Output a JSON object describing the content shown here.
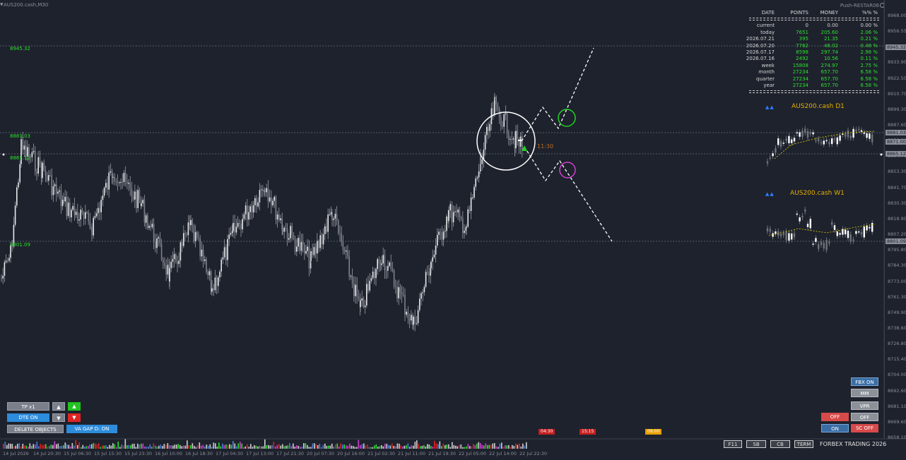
{
  "window": {
    "title": "AUS200.cash,M30",
    "right_label": "Push-RESTAR06"
  },
  "price_axis": {
    "ticks": [
      "8968.00",
      "8956.55",
      "8945.32",
      "8933.90",
      "8922.50",
      "8910.70",
      "8899.30",
      "8887.60",
      "8876.20",
      "8864.70",
      "8853.30",
      "8841.70",
      "8830.30",
      "8818.90",
      "8807.20",
      "8795.80",
      "8784.30",
      "8773.00",
      "8761.30",
      "8749.90",
      "8738.60",
      "8726.80",
      "8715.40",
      "8704.00",
      "8692.60",
      "8681.10",
      "8669.60",
      "8658.10"
    ],
    "boxed": [
      "8945.32",
      "8881.03",
      "8871.00",
      "8865.12",
      "8801.09"
    ]
  },
  "levels": [
    {
      "label": "8945.32"
    },
    {
      "label": "8881.03"
    },
    {
      "label": "8865.12"
    },
    {
      "label": "8801.09"
    }
  ],
  "time_axis": {
    "ticks": [
      "14 Jul 2026",
      "14 Jul 20:30",
      "15 Jul 06:30",
      "15 Jul 15:30",
      "15 Jul 23:30",
      "16 Jul 10:00",
      "16 Jul 18:30",
      "17 Jul 04:30",
      "17 Jul 13:00",
      "17 Jul 21:30",
      "20 Jul 07:30",
      "20 Jul 16:00",
      "21 Jul 02:30",
      "21 Jul 11:00",
      "21 Jul 19:30",
      "22 Jul 05:00",
      "22 Jul 14:00",
      "22 Jul 22:30"
    ]
  },
  "countdown": "11:30",
  "stats": {
    "headers": {
      "date": "DATE",
      "points": "POINTS",
      "money": "MONEY",
      "pct": "%% %"
    },
    "rows": [
      {
        "date": "current",
        "points": "0",
        "money": "0.00",
        "pct": "0.00 %",
        "positive": false
      },
      {
        "date": "today",
        "points": "7651",
        "money": "205.60",
        "pct": "2.06 %",
        "positive": true
      },
      {
        "date": "2026.07.21",
        "points": "395",
        "money": "21.35",
        "pct": "0.21 %",
        "positive": true
      },
      {
        "date": "2026.07.20",
        "points": "7762",
        "money": "48.02",
        "pct": "0.48 %",
        "positive": true
      },
      {
        "date": "2026.07.17",
        "points": "8598",
        "money": "297.74",
        "pct": "2.98 %",
        "positive": true
      },
      {
        "date": "2026.07.16",
        "points": "2492",
        "money": "10.56",
        "pct": "0.11 %",
        "positive": true
      },
      {
        "date": "week",
        "points": "15808",
        "money": "274.97",
        "pct": "2.75 %",
        "positive": true
      },
      {
        "date": "month",
        "points": "27234",
        "money": "657.70",
        "pct": "6.58 %",
        "positive": true
      },
      {
        "date": "quarter",
        "points": "27234",
        "money": "657.70",
        "pct": "6.58 %",
        "positive": true
      },
      {
        "date": "year",
        "points": "27234",
        "money": "657.70",
        "pct": "6.58 %",
        "positive": true
      }
    ]
  },
  "mini_charts": {
    "d1_title": "AUS200.cash D1",
    "w1_title": "AUS200.cash W1",
    "triangles": "▲▲"
  },
  "buttons_left": {
    "tp": "TP x1",
    "dte": "DTE ON",
    "delete": "DELETE OBJECTS",
    "vagap": "VA GAP D: ON",
    "up": "▲",
    "down": "▼"
  },
  "buttons_right": {
    "fbx": "FBX ON",
    "mm": "MM",
    "vpr": "VPR",
    "off_red": "OFF",
    "off_gray": "OFF",
    "on": "ON",
    "sc_off": "SC OFF"
  },
  "session_tags": [
    "04:30",
    "15:15",
    "09:00"
  ],
  "footer": {
    "f11": "F11",
    "sb": "SB",
    "cb": "CB",
    "term": "TERM",
    "brand": "FORBEX TRADING 2026"
  },
  "colors": {
    "background": "#1e222d",
    "candle": "#cfd2d6",
    "level_text": "#2ee02e",
    "positive": "#2ee02e",
    "accent_gold": "#e5b000",
    "dte_blue": "#2d8cdb"
  },
  "icons": {
    "menu": "triangle-down-icon",
    "settings": "circle-icon"
  }
}
